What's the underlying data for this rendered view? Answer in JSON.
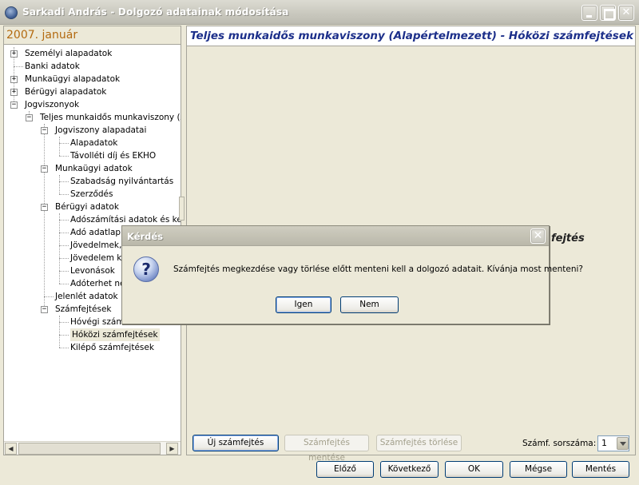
{
  "window": {
    "title": "Sarkadi András - Dolgozó adatainak módosítása",
    "icon": "globe-app-icon"
  },
  "left_panel": {
    "date_header": "2007. január",
    "tree": [
      {
        "label": "Személyi alapadatok",
        "level": 0,
        "toggle": "+"
      },
      {
        "label": "Banki adatok",
        "level": 0,
        "toggle": ""
      },
      {
        "label": "Munkaügyi alapadatok",
        "level": 0,
        "toggle": "+"
      },
      {
        "label": "Bérügyi alapadatok",
        "level": 0,
        "toggle": "+"
      },
      {
        "label": "Jogviszonyok",
        "level": 0,
        "toggle": "-"
      },
      {
        "label": "Teljes munkaidős munkaviszony (Ala",
        "level": 1,
        "toggle": "-"
      },
      {
        "label": "Jogviszony alapadatai",
        "level": 2,
        "toggle": "-"
      },
      {
        "label": "Alapadatok",
        "level": 3,
        "toggle": ""
      },
      {
        "label": "Távolléti díj és EKHO",
        "level": 3,
        "toggle": ""
      },
      {
        "label": "Munkaügyi adatok",
        "level": 2,
        "toggle": "-"
      },
      {
        "label": "Szabadság nyilvántartás",
        "level": 3,
        "toggle": ""
      },
      {
        "label": "Szerződés",
        "level": 3,
        "toggle": ""
      },
      {
        "label": "Bérügyi adatok",
        "level": 2,
        "toggle": "-"
      },
      {
        "label": "Adószámítási adatok és kedv",
        "level": 3,
        "toggle": ""
      },
      {
        "label": "Adó adatlap",
        "level": 3,
        "toggle": ""
      },
      {
        "label": "Jövedelmek, j",
        "level": 3,
        "toggle": ""
      },
      {
        "label": "Jövedelem kif",
        "level": 3,
        "toggle": ""
      },
      {
        "label": "Levonások",
        "level": 3,
        "toggle": ""
      },
      {
        "label": "Adóterhet ne",
        "level": 3,
        "toggle": ""
      },
      {
        "label": "Jelenlét adatok",
        "level": 2,
        "toggle": ""
      },
      {
        "label": "Számfejtések",
        "level": 2,
        "toggle": "-"
      },
      {
        "label": "Hóvégi számf",
        "level": 3,
        "toggle": ""
      },
      {
        "label": "Hóközi számfejtések",
        "level": 3,
        "toggle": "",
        "selected": true
      },
      {
        "label": "Kilépő számfejtések",
        "level": 3,
        "toggle": ""
      }
    ]
  },
  "right_panel": {
    "header": "Teljes munkaidős munkaviszony (Alapértelmezett) - Hóközi számfejtések",
    "peek_text": "fejtés",
    "buttons": {
      "new": "Új számfejtés",
      "save": "Számfejtés mentése",
      "delete": "Számfejtés törlése"
    },
    "sorszam_label": "Számf. sorszáma:",
    "sorszam_value": "1"
  },
  "footer": {
    "prev": "Előző",
    "next": "Következő",
    "ok": "OK",
    "cancel": "Mégse",
    "save": "Mentés"
  },
  "dialog": {
    "title": "Kérdés",
    "icon": "question-icon",
    "message": "Számfejtés megkezdése vagy törlése előtt menteni kell a dolgozó adatait. Kívánja most menteni?",
    "yes": "Igen",
    "no": "Nem"
  }
}
